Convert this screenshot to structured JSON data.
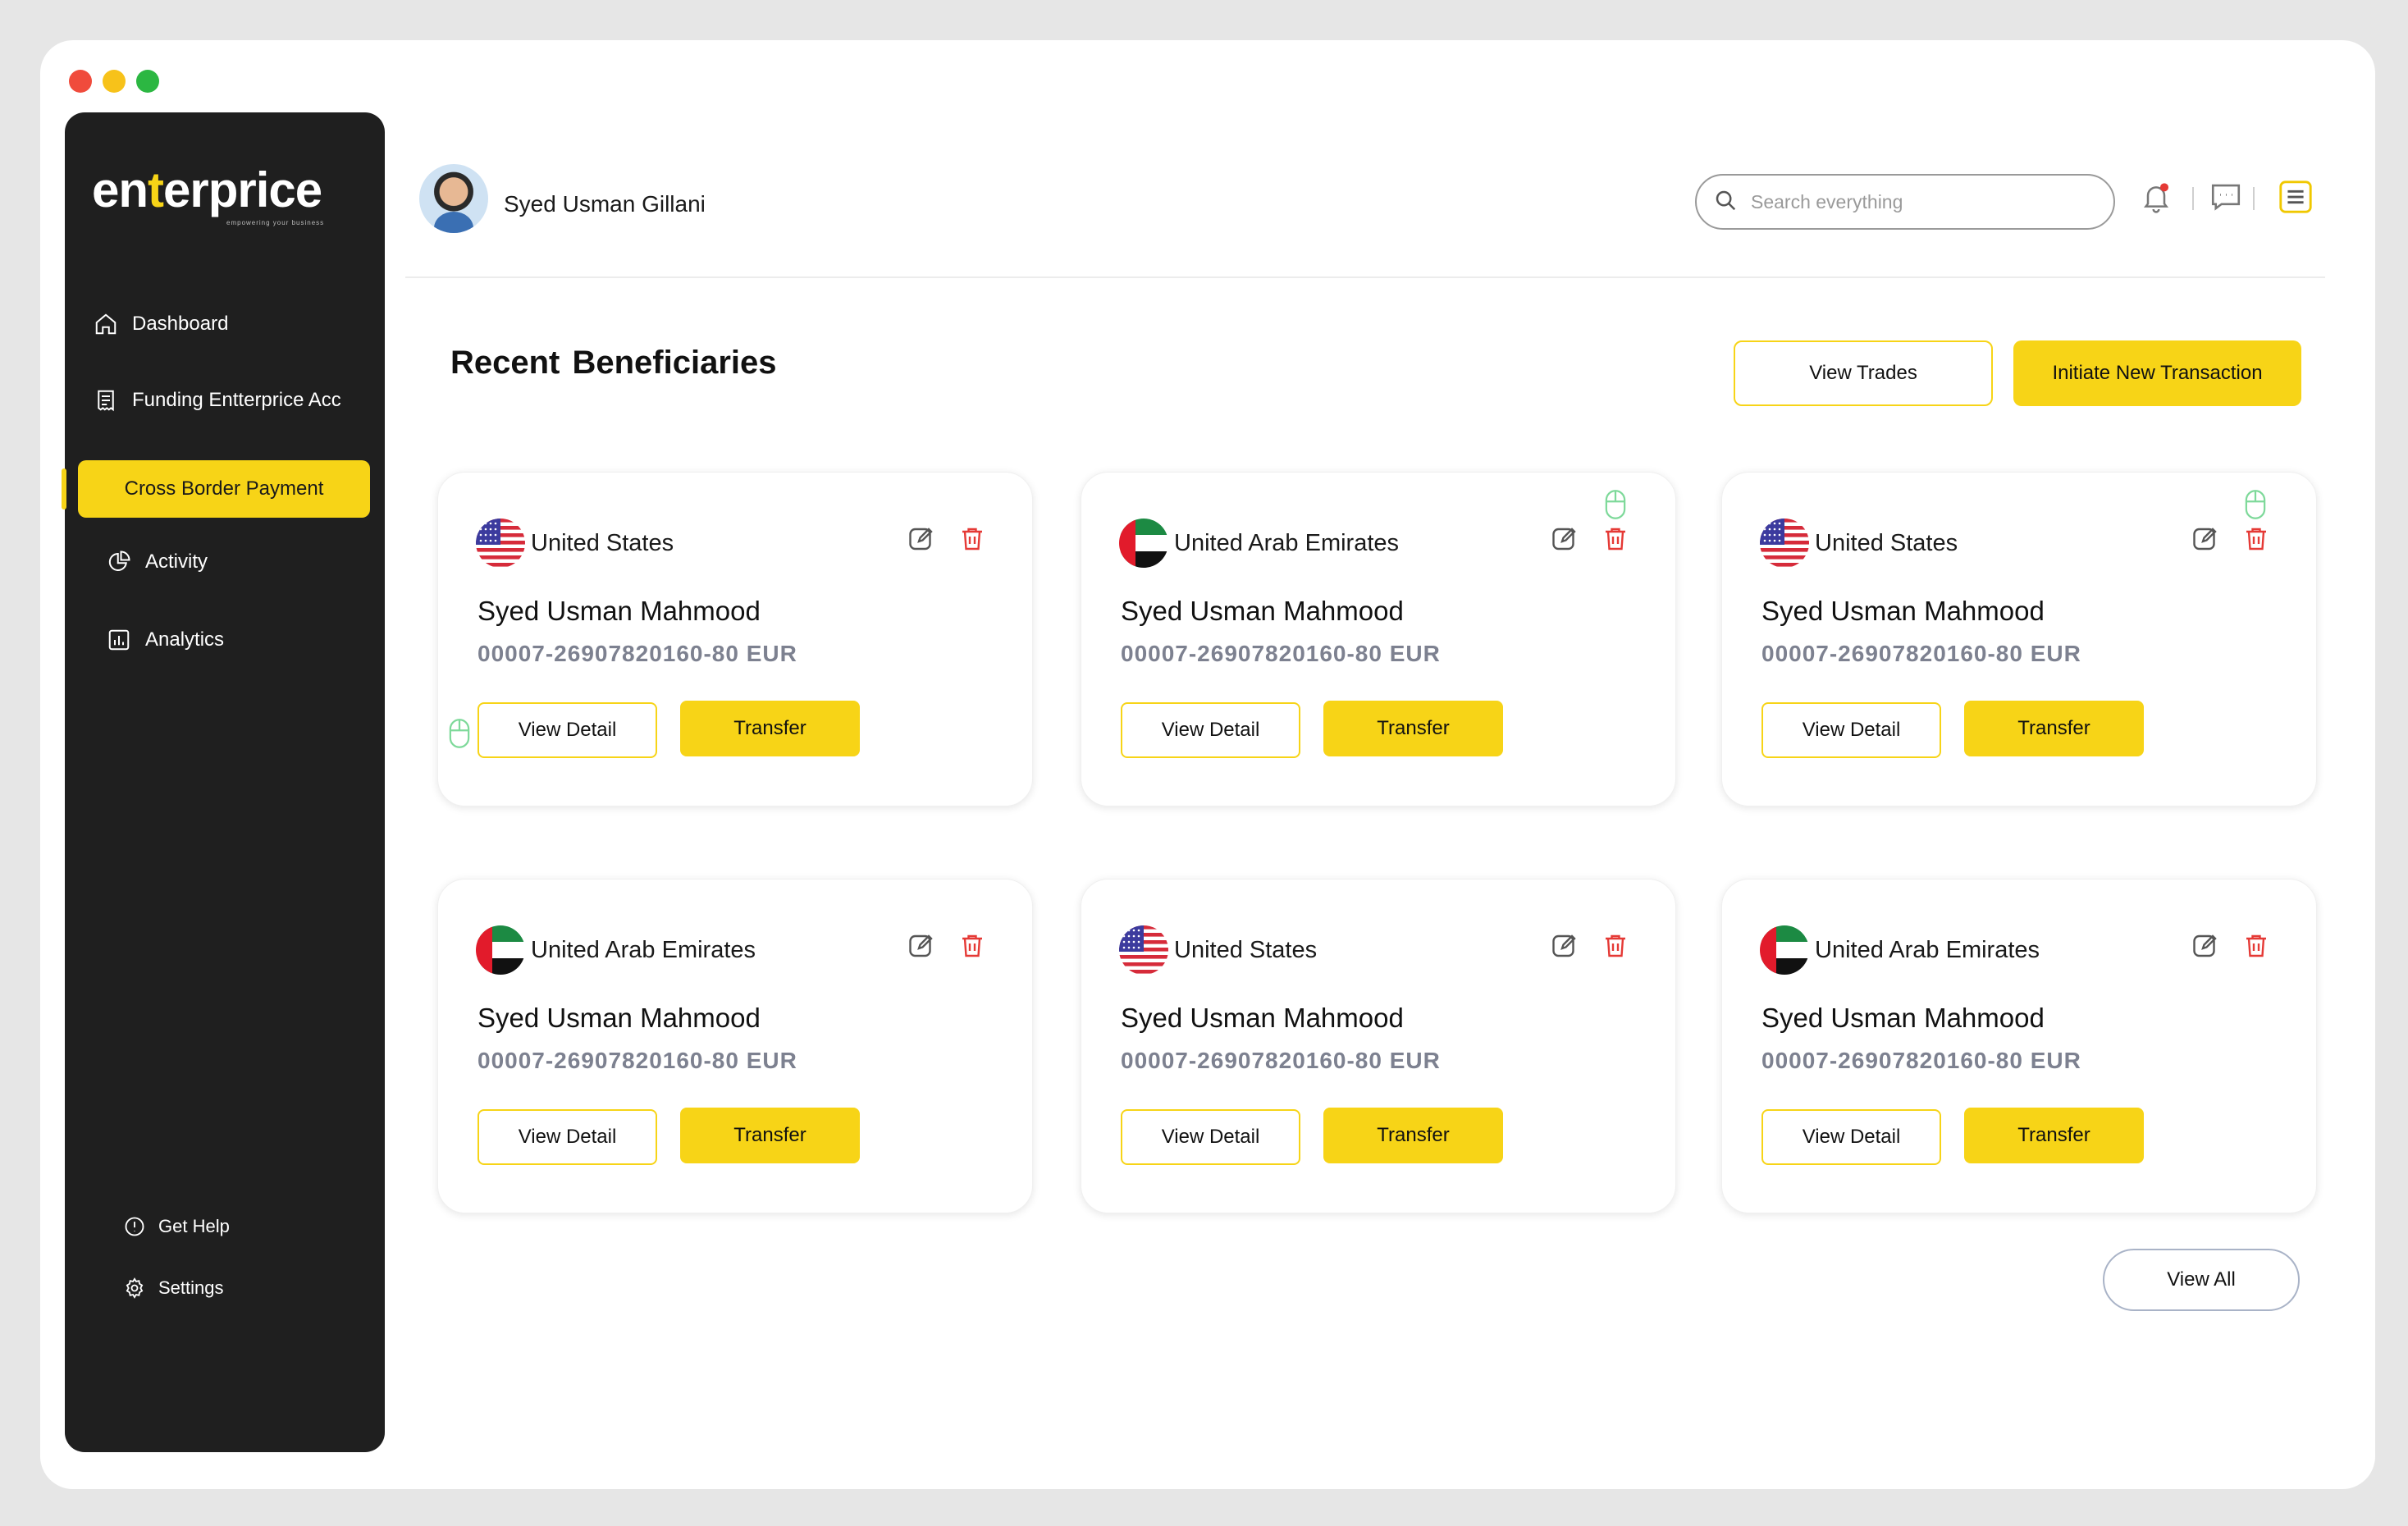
{
  "window_controls": [
    "close",
    "minimize",
    "maximize"
  ],
  "brand": {
    "logo_prefix": "en",
    "logo_accent": "t",
    "logo_suffix": "erprice",
    "tagline": "empowering your business",
    "accent_color": "#f7d417"
  },
  "sidebar": {
    "items": [
      {
        "label": "Dashboard",
        "icon": "home-icon"
      },
      {
        "label": "Funding Entterprice Acc",
        "icon": "receipt-icon"
      },
      {
        "label": "Cross Border Payment",
        "icon": "",
        "active": true
      },
      {
        "label": "Activity",
        "icon": "pie-chart-icon"
      },
      {
        "label": "Analytics",
        "icon": "bar-chart-icon"
      }
    ],
    "footer": [
      {
        "label": "Get Help",
        "icon": "info-icon"
      },
      {
        "label": "Settings",
        "icon": "gear-icon"
      }
    ]
  },
  "header": {
    "user_name": "Syed Usman Gillani",
    "search_placeholder": "Search everything",
    "icons": [
      "bell-icon",
      "chat-icon",
      "menu-icon"
    ],
    "notification_dot_color": "#e53935"
  },
  "main": {
    "title": "Recent Beneficiaries",
    "view_trades_label": "View Trades",
    "initiate_label": "Initiate New Transaction",
    "view_all_label": "View All",
    "cards": [
      {
        "country": "United States",
        "flag": "us",
        "name": "Syed Usman Mahmood",
        "account": "00007-26907820160-80 EUR",
        "view_label": "View Detail",
        "transfer_label": "Transfer"
      },
      {
        "country": "United Arab Emirates",
        "flag": "uae",
        "name": "Syed Usman Mahmood",
        "account": "00007-26907820160-80 EUR",
        "view_label": "View Detail",
        "transfer_label": "Transfer"
      },
      {
        "country": "United States",
        "flag": "us",
        "name": "Syed Usman Mahmood",
        "account": "00007-26907820160-80 EUR",
        "view_label": "View Detail",
        "transfer_label": "Transfer"
      },
      {
        "country": "United Arab Emirates",
        "flag": "uae",
        "name": "Syed Usman Mahmood",
        "account": "00007-26907820160-80 EUR",
        "view_label": "View Detail",
        "transfer_label": "Transfer"
      },
      {
        "country": "United States",
        "flag": "us",
        "name": "Syed Usman Mahmood",
        "account": "00007-26907820160-80 EUR",
        "view_label": "View Detail",
        "transfer_label": "Transfer"
      },
      {
        "country": "United Arab Emirates",
        "flag": "uae",
        "name": "Syed Usman Mahmood",
        "account": "00007-26907820160-80 EUR",
        "view_label": "View Detail",
        "transfer_label": "Transfer"
      }
    ]
  },
  "colors": {
    "sidebar_bg": "#1f1f1f",
    "primary": "#f7d417",
    "delete": "#e53935",
    "account_text": "#7d8190",
    "mouse_hint": "#7ed99a"
  }
}
